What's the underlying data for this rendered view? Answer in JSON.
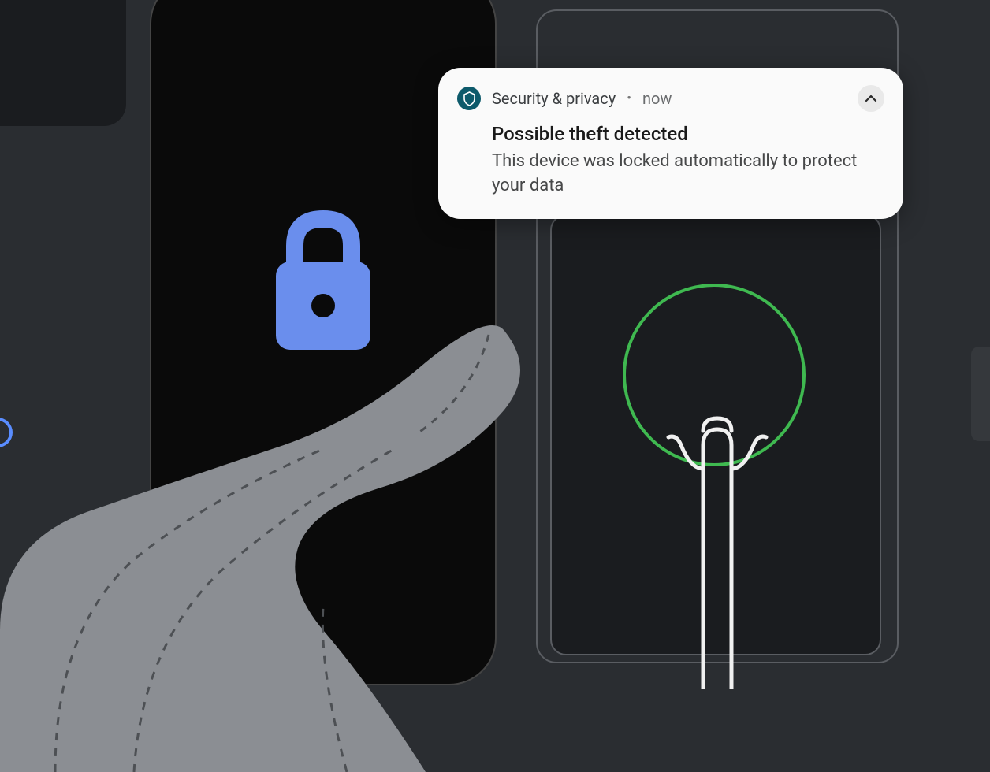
{
  "notification": {
    "app_name": "Security & privacy",
    "separator": "•",
    "timestamp": "now",
    "title": "Possible theft detected",
    "body": "This device was locked automatically to protect your data"
  },
  "icons": {
    "lock": "lock-icon",
    "shield": "shield-icon",
    "chevron": "chevron-up-icon"
  },
  "colors": {
    "lock_blue": "#6a8eed",
    "ring_green": "#3fb950",
    "notif_icon_bg": "#0d5a6b",
    "background": "#2a2d31"
  }
}
